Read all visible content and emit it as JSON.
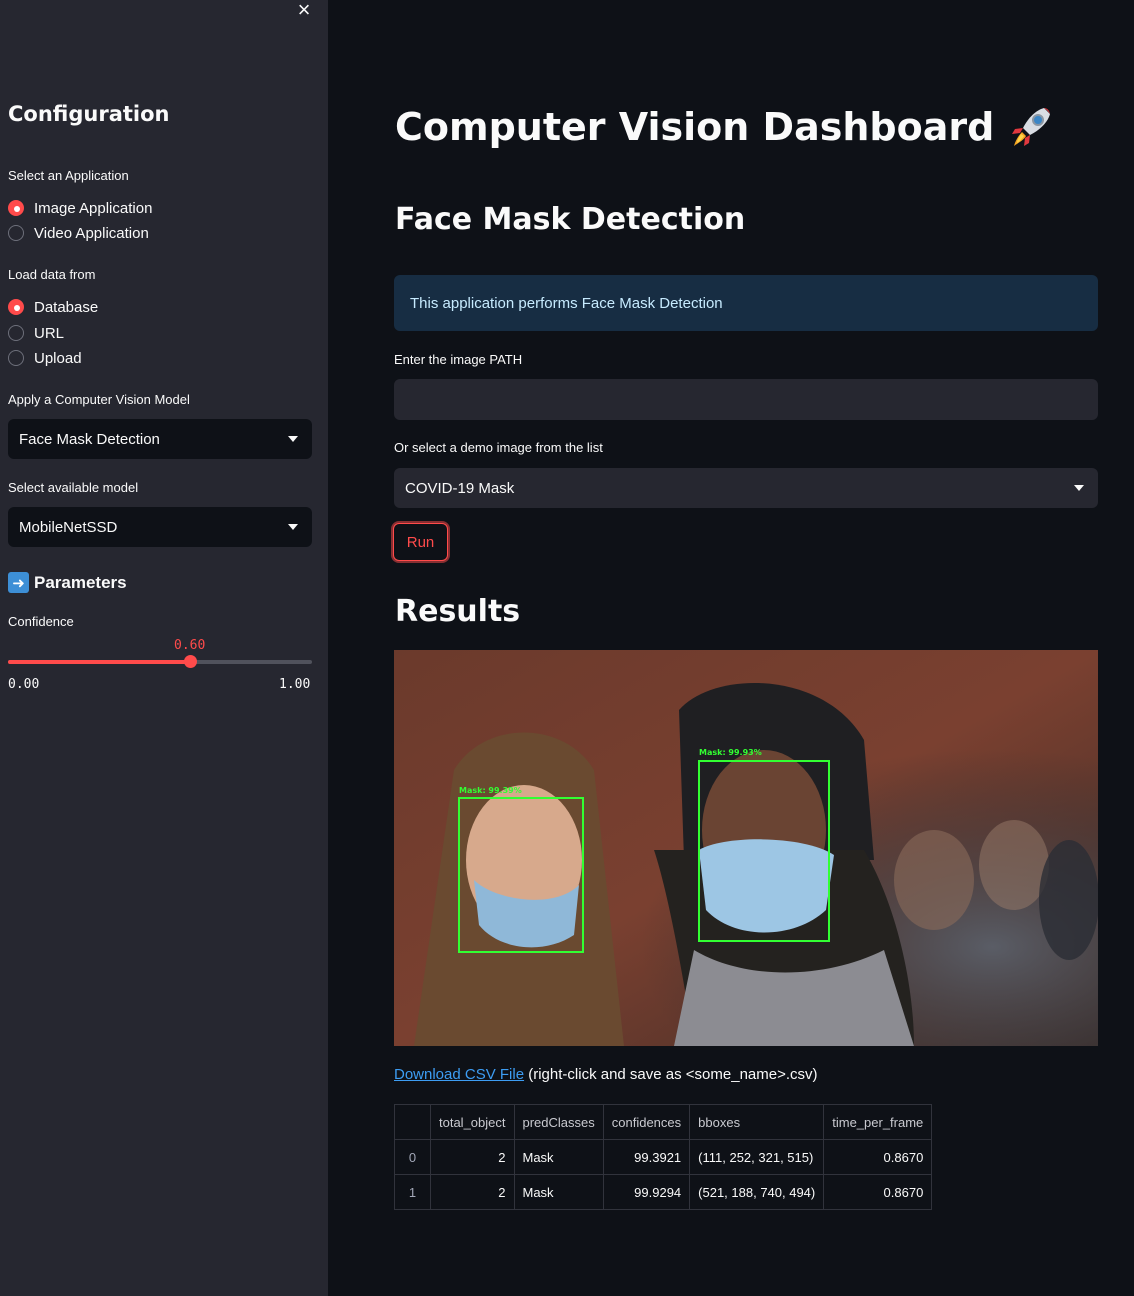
{
  "sidebar": {
    "close_glyph": "×",
    "title": "Configuration",
    "app_label": "Select an Application",
    "app_options": [
      "Image Application",
      "Video Application"
    ],
    "app_selected": 0,
    "source_label": "Load data from",
    "source_options": [
      "Database",
      "URL",
      "Upload"
    ],
    "source_selected": 0,
    "model_label": "Apply a Computer Vision Model",
    "model_value": "Face Mask Detection",
    "available_label": "Select available model",
    "available_value": "MobileNetSSD",
    "params_title": "Parameters",
    "params_icon": "right-arrow-icon",
    "confidence_label": "Confidence",
    "confidence_value": "0.60",
    "confidence_fraction": 0.6,
    "confidence_min": "0.00",
    "confidence_max": "1.00"
  },
  "main": {
    "title": "Computer Vision Dashboard",
    "title_icon": "rocket-icon",
    "section_title": "Face Mask Detection",
    "info_text": "This application performs Face Mask Detection",
    "path_label": "Enter the image PATH",
    "path_value": "",
    "demo_label": "Or select a demo image from the list",
    "demo_value": "COVID-19 Mask",
    "run_label": "Run",
    "results_title": "Results",
    "detections": [
      {
        "label": "Mask: 99.39%"
      },
      {
        "label": "Mask: 99.93%"
      }
    ],
    "download_link": "Download CSV File",
    "download_hint": "(right-click and save as <some_name>.csv)",
    "table": {
      "columns": [
        "",
        "total_object",
        "predClasses",
        "confidences",
        "bboxes",
        "time_per_frame"
      ],
      "rows": [
        [
          "0",
          "2",
          "Mask",
          "99.3921",
          "(111, 252, 321, 515)",
          "0.8670"
        ],
        [
          "1",
          "2",
          "Mask",
          "99.9294",
          "(521, 188, 740, 494)",
          "0.8670"
        ]
      ]
    }
  },
  "colors": {
    "background": "#0e1117",
    "sidebar": "#262730",
    "accent": "#ff4b4b",
    "info_bg": "#172d43",
    "link": "#3d9df3",
    "bbox": "#32ff32"
  }
}
